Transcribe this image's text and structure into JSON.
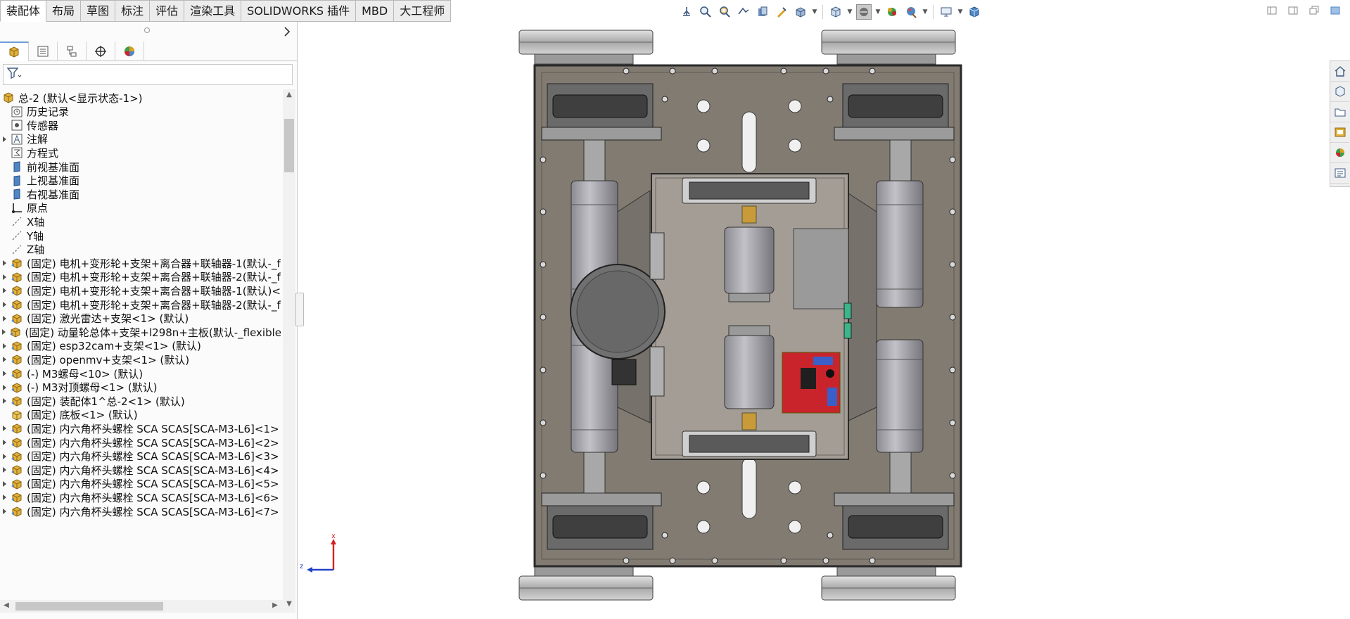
{
  "command_tabs": [
    {
      "label": "装配体",
      "active": true
    },
    {
      "label": "布局",
      "active": false
    },
    {
      "label": "草图",
      "active": false
    },
    {
      "label": "标注",
      "active": false
    },
    {
      "label": "评估",
      "active": false
    },
    {
      "label": "渲染工具",
      "active": false
    },
    {
      "label": "SOLIDWORKS 插件",
      "active": false
    },
    {
      "label": "MBD",
      "active": false
    },
    {
      "label": "大工程师",
      "active": false
    }
  ],
  "heads_up_toolbar": [
    "view-orientation-icon",
    "zoom-to-fit-icon",
    "zoom-area-icon",
    "previous-view-icon",
    "section-view-icon",
    "dynamic-annotation-icon",
    "view-settings-icon",
    "view-orientation-cube-icon",
    "display-style-icon",
    "hide-show-icon",
    "edit-appearance-icon",
    "apply-scene-icon",
    "view-setting-display-icon",
    "3d-view-icon"
  ],
  "tree": {
    "root": "总-2  (默认<显示状态-1>)",
    "items": [
      {
        "label": "历史记录",
        "icon": "history-icon",
        "expandable": false
      },
      {
        "label": "传感器",
        "icon": "sensor-icon",
        "expandable": false
      },
      {
        "label": "注解",
        "icon": "annotation-icon",
        "expandable": true
      },
      {
        "label": "方程式",
        "icon": "equation-icon",
        "expandable": false
      },
      {
        "label": "前视基准面",
        "icon": "plane-icon",
        "expandable": false
      },
      {
        "label": "上视基准面",
        "icon": "plane-icon",
        "expandable": false
      },
      {
        "label": "右视基准面",
        "icon": "plane-icon",
        "expandable": false
      },
      {
        "label": "原点",
        "icon": "origin-icon",
        "expandable": false
      },
      {
        "label": "X轴",
        "icon": "axis-icon",
        "expandable": false
      },
      {
        "label": "Y轴",
        "icon": "axis-icon",
        "expandable": false
      },
      {
        "label": "Z轴",
        "icon": "axis-icon",
        "expandable": false
      },
      {
        "label": "(固定) 电机+变形轮+支架+离合器+联轴器-1(默认-_f",
        "icon": "subassembly-icon",
        "expandable": true
      },
      {
        "label": "(固定) 电机+变形轮+支架+离合器+联轴器-2(默认-_f",
        "icon": "subassembly-icon",
        "expandable": true
      },
      {
        "label": "(固定) 电机+变形轮+支架+离合器+联轴器-1(默认)<",
        "icon": "subassembly-icon",
        "expandable": true
      },
      {
        "label": "(固定) 电机+变形轮+支架+离合器+联轴器-2(默认-_f",
        "icon": "subassembly-icon",
        "expandable": true
      },
      {
        "label": "(固定) 激光雷达+支架<1> (默认)",
        "icon": "subassembly-icon",
        "expandable": true
      },
      {
        "label": "(固定) 动量轮总体+支架+l298n+主板(默认-_flexible",
        "icon": "subassembly-icon",
        "expandable": true
      },
      {
        "label": "(固定) esp32cam+支架<1> (默认)",
        "icon": "subassembly-icon",
        "expandable": true
      },
      {
        "label": "(固定) openmv+支架<1> (默认)",
        "icon": "subassembly-icon",
        "expandable": true
      },
      {
        "label": "(-) M3螺母<10> (默认)",
        "icon": "subassembly-icon",
        "expandable": true
      },
      {
        "label": "(-) M3对顶螺母<1> (默认)",
        "icon": "subassembly-icon",
        "expandable": true
      },
      {
        "label": "(固定) 装配体1^总-2<1> (默认)",
        "icon": "subassembly-icon",
        "expandable": true
      },
      {
        "label": "(固定) 底板<1> (默认)",
        "icon": "part-icon",
        "expandable": false
      },
      {
        "label": "(固定) 内六角杯头螺栓 SCA SCAS[SCA-M3-L6]<1>",
        "icon": "subassembly-icon",
        "expandable": true
      },
      {
        "label": "(固定) 内六角杯头螺栓 SCA SCAS[SCA-M3-L6]<2>",
        "icon": "subassembly-icon",
        "expandable": true
      },
      {
        "label": "(固定) 内六角杯头螺栓 SCA SCAS[SCA-M3-L6]<3>",
        "icon": "subassembly-icon",
        "expandable": true
      },
      {
        "label": "(固定) 内六角杯头螺栓 SCA SCAS[SCA-M3-L6]<4>",
        "icon": "subassembly-icon",
        "expandable": true
      },
      {
        "label": "(固定) 内六角杯头螺栓 SCA SCAS[SCA-M3-L6]<5>",
        "icon": "subassembly-icon",
        "expandable": true
      },
      {
        "label": "(固定) 内六角杯头螺栓 SCA SCAS[SCA-M3-L6]<6>",
        "icon": "subassembly-icon",
        "expandable": true
      },
      {
        "label": "(固定) 内六角杯头螺栓 SCA SCAS[SCA-M3-L6]<7>",
        "icon": "subassembly-icon",
        "expandable": true
      }
    ]
  },
  "triad": {
    "x_label": "x",
    "z_label": "z"
  },
  "colors": {
    "accent": "#6d9ed8",
    "axis_red": "#d62020",
    "axis_blue": "#2243c8",
    "plate": "#817b72",
    "pcb": "#c9242c"
  }
}
